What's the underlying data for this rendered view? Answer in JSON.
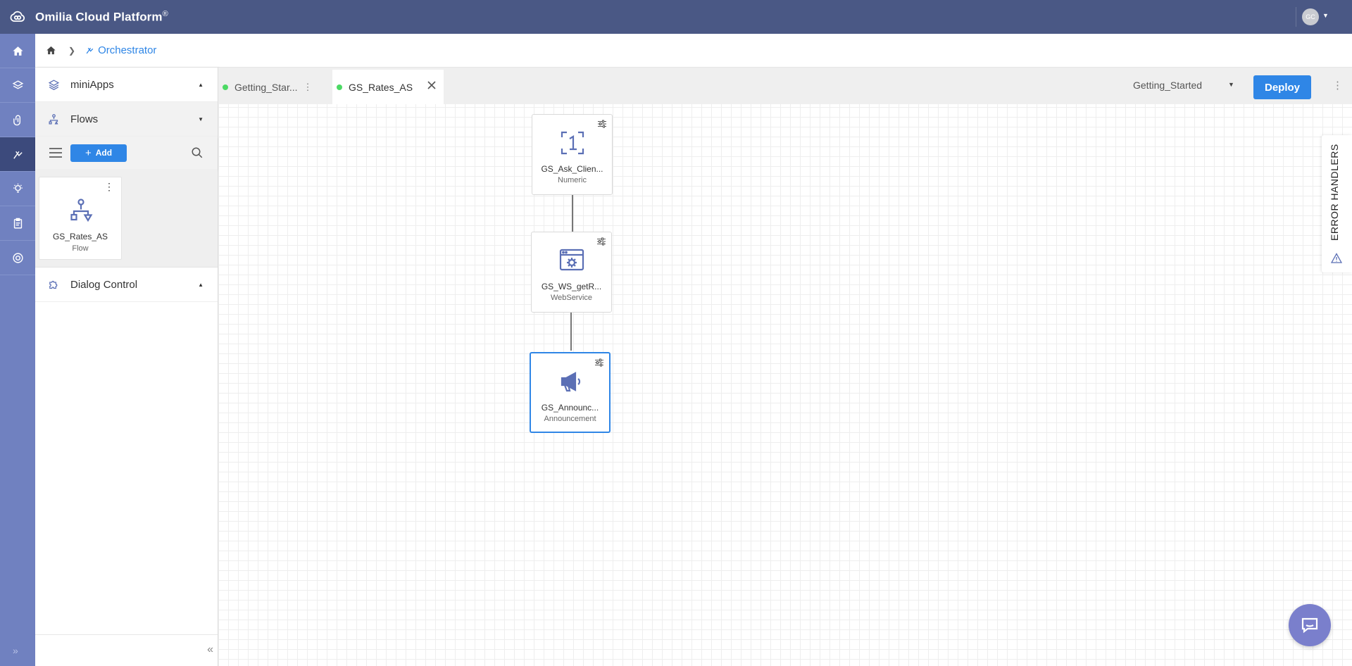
{
  "app": {
    "brand": "Omilia Cloud Platform",
    "brand_mark": "®",
    "avatar_initials": "GC"
  },
  "breadcrumb": {
    "current": "Orchestrator"
  },
  "sidebar": {
    "sections": [
      {
        "label": "miniApps",
        "icon": "layers-icon"
      },
      {
        "label": "Flows",
        "icon": "flow-icon"
      },
      {
        "label": "Dialog Control",
        "icon": "puzzle-icon"
      }
    ],
    "toolbar": {
      "add_label": "Add"
    },
    "flows": [
      {
        "name": "GS_Rates_AS",
        "type": "Flow"
      }
    ]
  },
  "tabs": [
    {
      "label": "Getting_Star...",
      "status": "active"
    },
    {
      "label": "GS_Rates_AS",
      "status": "active"
    }
  ],
  "environment": {
    "selected": "Getting_Started"
  },
  "deploy_label": "Deploy",
  "nodes": [
    {
      "name": "GS_Ask_Clien...",
      "type": "Numeric"
    },
    {
      "name": "GS_WS_getR...",
      "type": "WebService"
    },
    {
      "name": "GS_Announc...",
      "type": "Announcement"
    }
  ],
  "error_handlers_label": "ERROR HANDLERS",
  "colors": {
    "header": "#4a5885",
    "rail": "#7081c0",
    "accent": "#2f86e6",
    "status_dot": "#4cd964",
    "icon": "#5b6fb5"
  }
}
